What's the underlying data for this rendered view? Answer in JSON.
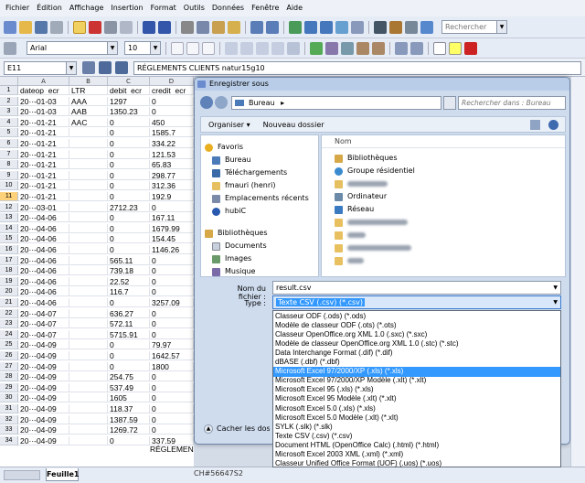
{
  "menu": [
    "Fichier",
    "Édition",
    "Affichage",
    "Insertion",
    "Format",
    "Outils",
    "Données",
    "Fenêtre",
    "Aide"
  ],
  "toolbar": {
    "search_placeholder": "Rechercher",
    "font": "Arial",
    "size": "10"
  },
  "formula": {
    "cellref": "E11",
    "content": "RÉGLEMENTS CLIENTS natur15g10"
  },
  "sheet": {
    "columns": [
      "A",
      "B",
      "C",
      "D"
    ],
    "rows": [
      {
        "n": "1",
        "a": "dateop_ecr",
        "b": "LTR",
        "c": "debit_ecr",
        "d": "credit_ecr"
      },
      {
        "n": "2",
        "a": "20··-01-03",
        "b": "AAA",
        "c": "1297",
        "d": "0"
      },
      {
        "n": "3",
        "a": "20··-01-03",
        "b": "AAB",
        "c": "1350.23",
        "d": "0"
      },
      {
        "n": "4",
        "a": "20··-01-21",
        "b": "AAC",
        "c": "0",
        "d": "450"
      },
      {
        "n": "5",
        "a": "20··-01-21",
        "b": "",
        "c": "0",
        "d": "1585.7"
      },
      {
        "n": "6",
        "a": "20··-01-21",
        "b": "",
        "c": "0",
        "d": "334.22"
      },
      {
        "n": "7",
        "a": "20··-01-21",
        "b": "",
        "c": "0",
        "d": "121.53"
      },
      {
        "n": "8",
        "a": "20··-01-21",
        "b": "",
        "c": "0",
        "d": "65.83"
      },
      {
        "n": "9",
        "a": "20··-01-21",
        "b": "",
        "c": "0",
        "d": "298.77"
      },
      {
        "n": "10",
        "a": "20··-01-21",
        "b": "",
        "c": "0",
        "d": "312.36"
      },
      {
        "n": "11",
        "a": "20··-01-21",
        "b": "",
        "c": "0",
        "d": "192.9"
      },
      {
        "n": "12",
        "a": "20··-03-01",
        "b": "",
        "c": "2712.23",
        "d": "0"
      },
      {
        "n": "13",
        "a": "20··-04-06",
        "b": "",
        "c": "0",
        "d": "167.11"
      },
      {
        "n": "14",
        "a": "20··-04-06",
        "b": "",
        "c": "0",
        "d": "1679.99"
      },
      {
        "n": "15",
        "a": "20··-04-06",
        "b": "",
        "c": "0",
        "d": "154.45"
      },
      {
        "n": "16",
        "a": "20··-04-06",
        "b": "",
        "c": "0",
        "d": "1146.26"
      },
      {
        "n": "17",
        "a": "20··-04-06",
        "b": "",
        "c": "565.11",
        "d": "0"
      },
      {
        "n": "18",
        "a": "20··-04-06",
        "b": "",
        "c": "739.18",
        "d": "0"
      },
      {
        "n": "19",
        "a": "20··-04-06",
        "b": "",
        "c": "22.52",
        "d": "0"
      },
      {
        "n": "20",
        "a": "20··-04-06",
        "b": "",
        "c": "116.7",
        "d": "0"
      },
      {
        "n": "21",
        "a": "20··-04-06",
        "b": "",
        "c": "0",
        "d": "3257.09"
      },
      {
        "n": "22",
        "a": "20··-04-07",
        "b": "",
        "c": "636.27",
        "d": "0"
      },
      {
        "n": "23",
        "a": "20··-04-07",
        "b": "",
        "c": "572.11",
        "d": "0"
      },
      {
        "n": "24",
        "a": "20··-04-07",
        "b": "",
        "c": "5715.91",
        "d": "0"
      },
      {
        "n": "25",
        "a": "20··-04-09",
        "b": "",
        "c": "0",
        "d": "79.97"
      },
      {
        "n": "26",
        "a": "20··-04-09",
        "b": "",
        "c": "0",
        "d": "1642.57"
      },
      {
        "n": "27",
        "a": "20··-04-09",
        "b": "",
        "c": "0",
        "d": "1800"
      },
      {
        "n": "28",
        "a": "20··-04-09",
        "b": "",
        "c": "254.75",
        "d": "0"
      },
      {
        "n": "29",
        "a": "20··-04-09",
        "b": "",
        "c": "537.49",
        "d": "0"
      },
      {
        "n": "30",
        "a": "20··-04-09",
        "b": "",
        "c": "1605",
        "d": "0"
      },
      {
        "n": "31",
        "a": "20··-04-09",
        "b": "",
        "c": "118.37",
        "d": "0"
      },
      {
        "n": "32",
        "a": "20··-04-09",
        "b": "",
        "c": "1387.59",
        "d": "0"
      },
      {
        "n": "33",
        "a": "20··-04-09",
        "b": "",
        "c": "1269.72",
        "d": "0"
      },
      {
        "n": "34",
        "a": "20··-04-09",
        "b": "",
        "c": "0",
        "d": "337.59"
      }
    ],
    "sheet_tab": "Feuille1",
    "overflow_text_1": "RÉGLEMENTS CLIE",
    "overflow_text_2": "CH#56647S2"
  },
  "dialog": {
    "title": "Enregistrer sous",
    "address": "Bureau",
    "search_placeholder": "Rechercher dans : Bureau",
    "organize": "Organiser",
    "new_folder": "Nouveau dossier",
    "nav": {
      "favorites": "Favoris",
      "bureau": "Bureau",
      "downloads": "Téléchargements",
      "user": "fmauri (henri)",
      "recent": "Emplacements récents",
      "hubic": "hubiC",
      "libraries": "Bibliothèques",
      "documents": "Documents",
      "images": "Images",
      "music": "Musique"
    },
    "file_column": "Nom",
    "files": [
      "Bibliothèques",
      "Groupe résidentiel",
      "",
      "Ordinateur",
      "Réseau",
      "",
      "",
      "",
      ""
    ],
    "filename_label": "Nom du fichier :",
    "filename_value": "result.csv",
    "type_label": "Type :",
    "type_value": "Texte CSV (.csv) (*.csv)",
    "hide_folders": "Cacher les dossiers",
    "type_options": [
      "Classeur ODF (.ods) (*.ods)",
      "Modèle de classeur ODF (.ots) (*.ots)",
      "Classeur OpenOffice.org XML 1.0 (.sxc) (*.sxc)",
      "Modèle de classeur OpenOffice.org XML 1.0 (.stc) (*.stc)",
      "Data Interchange Format (.dif) (*.dif)",
      "dBASE (.dbf) (*.dbf)",
      "Microsoft Excel 97/2000/XP (.xls) (*.xls)",
      "Microsoft Excel 97/2000/XP Modèle (.xlt) (*.xlt)",
      "Microsoft Excel 95 (.xls) (*.xls)",
      "Microsoft Excel 95 Modèle (.xlt) (*.xlt)",
      "Microsoft Excel 5.0 (.xls) (*.xls)",
      "Microsoft Excel 5.0 Modèle (.xlt) (*.xlt)",
      "SYLK (.slk) (*.slk)",
      "Texte CSV (.csv) (*.csv)",
      "Document HTML (OpenOffice Calc) (.html) (*.html)",
      "Microsoft Excel 2003 XML (.xml) (*.xml)",
      "Classeur Unified Office Format (UOF) (.uos) (*.uos)"
    ],
    "selected_index": 6
  },
  "colors": {
    "accent": "#3399ff",
    "dialog_bg": "#cfdcee"
  }
}
